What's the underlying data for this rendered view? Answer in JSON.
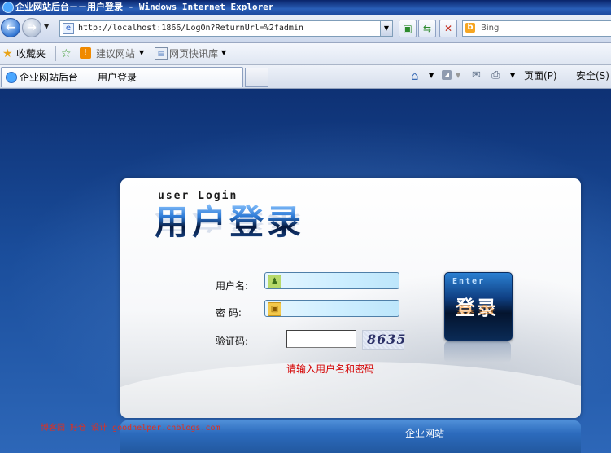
{
  "window": {
    "title": "企业网站后台－－用户登录 - Windows Internet Explorer"
  },
  "address_bar": {
    "url": "http://localhost:1866/LogOn?ReturnUrl=%2fadmin"
  },
  "search": {
    "placeholder": "Bing"
  },
  "favorites_bar": {
    "label": "收藏夹",
    "items": [
      {
        "label": "建议网站"
      },
      {
        "label": "网页快讯库"
      }
    ]
  },
  "tab": {
    "title": "企业网站后台－－用户登录"
  },
  "command_bar": {
    "page_label": "页面(P)",
    "safety_label": "安全(S)"
  },
  "login": {
    "heading_en": "user Login",
    "heading_zh": "用户登录",
    "username_label": "用户名:",
    "password_label": "密 码:",
    "captcha_label": "验证码:",
    "captcha_text": "8635",
    "message": "请输入用户名和密码",
    "enter_en": "Enter",
    "enter_zh": "登录"
  },
  "footer": {
    "site_name": "企业网站",
    "credit": "博客园 好仓 设计  goodhelper.cnblogs.com"
  },
  "colors": {
    "message": "#d40000",
    "page_bg": "#1a4d9b",
    "credit": "#e03020"
  }
}
